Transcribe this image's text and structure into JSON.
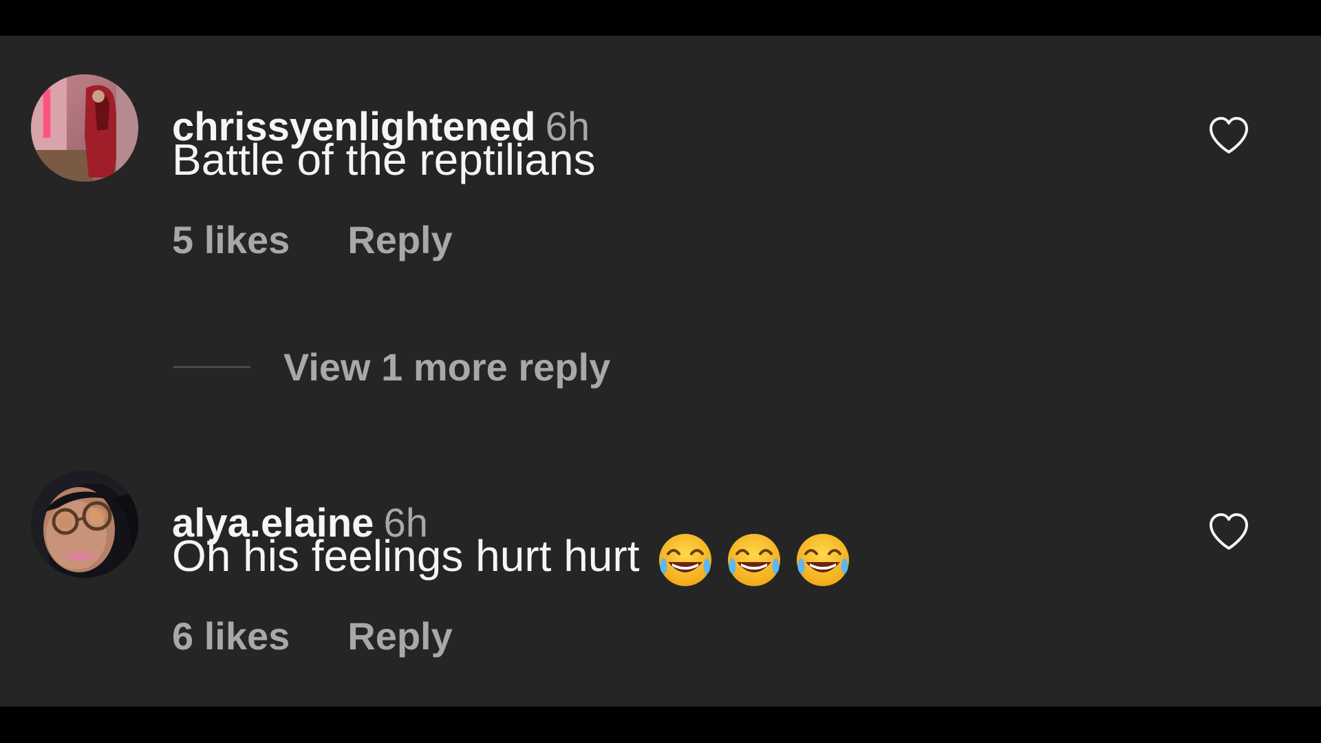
{
  "comments": [
    {
      "username": "chrissyenlightened",
      "time": "6h",
      "text": "Battle of the reptilians",
      "likes": "5 likes",
      "reply_label": "Reply",
      "avatar_icon": "user-avatar-photo",
      "like_icon": "heart-outline-icon"
    },
    {
      "username": "alya.elaine",
      "time": "6h",
      "text": "Oh his feelings hurt hurt",
      "emojis": [
        "face-with-tears-of-joy",
        "face-with-tears-of-joy",
        "face-with-tears-of-joy"
      ],
      "likes": "6 likes",
      "reply_label": "Reply",
      "avatar_icon": "user-avatar-photo",
      "like_icon": "heart-outline-icon"
    }
  ],
  "view_replies": {
    "label": "View 1 more reply"
  },
  "colors": {
    "background": "#252525",
    "frame": "#000000",
    "primary_text": "#f5f5f5",
    "secondary_text": "#a8a8a8"
  }
}
